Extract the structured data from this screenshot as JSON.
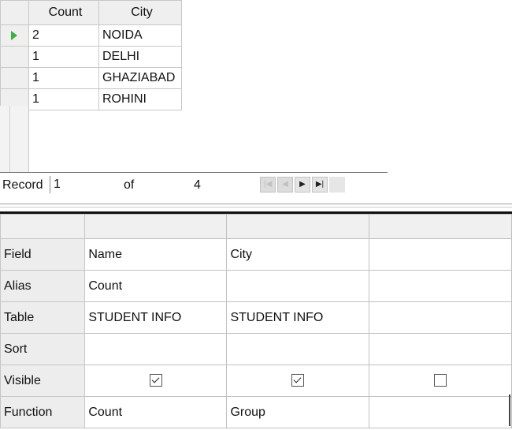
{
  "result_grid": {
    "columns": [
      "Count",
      "City"
    ],
    "rows": [
      {
        "count": "2",
        "city": "NOIDA"
      },
      {
        "count": "1",
        "city": "DELHI"
      },
      {
        "count": "1",
        "city": "GHAZIABAD"
      },
      {
        "count": "1",
        "city": "ROHINI"
      }
    ]
  },
  "record_bar": {
    "label": "Record",
    "current": "1",
    "of_label": "of",
    "total": "4",
    "nav_icons": [
      "first-record-icon",
      "prev-record-icon",
      "next-record-icon",
      "last-record-icon"
    ]
  },
  "design_grid": {
    "row_labels": {
      "field": "Field",
      "alias": "Alias",
      "table": "Table",
      "sort": "Sort",
      "visible": "Visible",
      "function": "Function"
    },
    "columns": [
      {
        "field": "Name",
        "alias": "Count",
        "table": "STUDENT INFO",
        "sort": "",
        "visible": true,
        "function": "Count"
      },
      {
        "field": "City",
        "alias": "",
        "table": "STUDENT INFO",
        "sort": "",
        "visible": true,
        "function": "Group"
      },
      {
        "field": "",
        "alias": "",
        "table": "",
        "sort": "",
        "visible": false,
        "function": ""
      }
    ]
  },
  "colors": {
    "current_row_arrow": "#3cb043",
    "header_bg": "#efefef",
    "grid_line": "#c8c8c8"
  }
}
